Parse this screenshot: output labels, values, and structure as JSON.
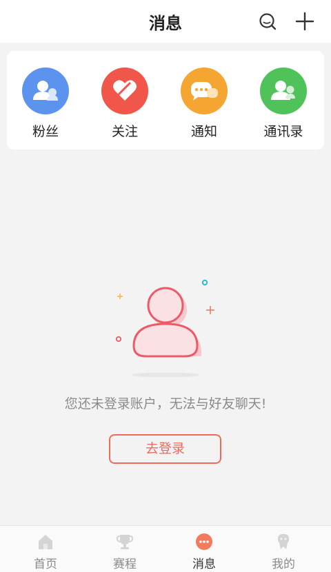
{
  "header": {
    "title": "消息",
    "search_icon": "search-icon",
    "add_icon": "plus-icon"
  },
  "quick_entries": [
    {
      "label": "粉丝",
      "icon": "user-follow-icon",
      "color": "#5b93ee"
    },
    {
      "label": "关注",
      "icon": "heart-icon",
      "color": "#f0574a"
    },
    {
      "label": "通知",
      "icon": "chat-bubble-icon",
      "color": "#f5a531"
    },
    {
      "label": "通讯录",
      "icon": "contacts-icon",
      "color": "#50c25a"
    }
  ],
  "empty_state": {
    "illustration": "user-placeholder-icon",
    "message": "您还未登录账户，无法与好友聊天!",
    "button_label": "去登录",
    "accent_color": "#f06a5a"
  },
  "tabbar": {
    "tabs": [
      {
        "label": "首页",
        "icon": "home-icon",
        "active": false
      },
      {
        "label": "赛程",
        "icon": "trophy-icon",
        "active": false
      },
      {
        "label": "消息",
        "icon": "message-icon",
        "active": true
      },
      {
        "label": "我的",
        "icon": "profile-icon",
        "active": false
      }
    ]
  }
}
